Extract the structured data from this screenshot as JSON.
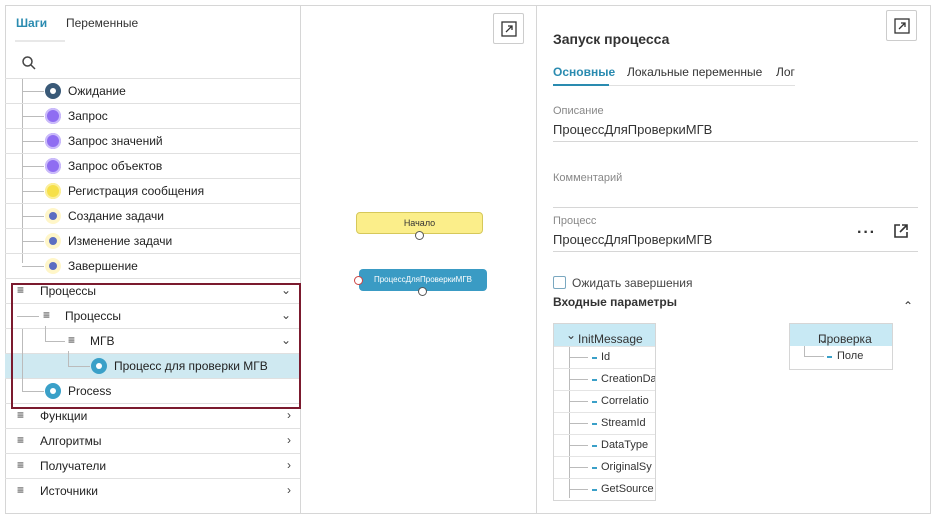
{
  "left_panel": {
    "tabs": [
      "Шаги",
      "Переменные"
    ],
    "steps": [
      {
        "label": "Ожидание",
        "icon": "gear-icon"
      },
      {
        "label": "Запрос",
        "icon": "request-icon"
      },
      {
        "label": "Запрос значений",
        "icon": "request-values-icon"
      },
      {
        "label": "Запрос объектов",
        "icon": "request-objects-icon"
      },
      {
        "label": "Регистрация сообщения",
        "icon": "message-icon"
      },
      {
        "label": "Создание задачи",
        "icon": "gear-icon"
      },
      {
        "label": "Изменение задачи",
        "icon": "gear-icon"
      },
      {
        "label": "Завершение",
        "icon": "gear-icon"
      }
    ],
    "groups": [
      {
        "label": "Процессы",
        "expanded": true
      },
      {
        "label": "Процессы",
        "expanded": true
      },
      {
        "label": "МГВ",
        "expanded": true
      }
    ],
    "selected_item": "Процесс для проверки МГВ",
    "process_item": "Process",
    "categories": [
      "Функции",
      "Алгоритмы",
      "Получатели",
      "Источники"
    ]
  },
  "canvas": {
    "start_node": "Начало",
    "process_node": "ПроцессДляПроверкиМГВ"
  },
  "right_panel": {
    "title": "Запуск процесса",
    "tabs": [
      "Основные",
      "Локальные переменные",
      "Лог"
    ],
    "description_label": "Описание",
    "description_value": "ПроцессДляПроверкиМГВ",
    "comment_label": "Комментарий",
    "process_label": "Процесс",
    "process_value": "ПроцессДляПроверкиМГВ",
    "more_label": "···",
    "wait_label": "Ожидать завершения",
    "wait_checked": false,
    "input_params_title": "Входные параметры",
    "source_header": "InitMessage",
    "source_fields": [
      "Id",
      "CreationDa",
      "Correlatio",
      "StreamId",
      "DataType",
      "OriginalSy",
      "GetSource"
    ],
    "target_header": "Проверка",
    "target_fields": [
      "Поле"
    ]
  },
  "colors": {
    "accent": "#2a8bb0",
    "highlight_border": "#7b1a2e",
    "selected_row": "#cfe9f1",
    "start_node": "#fbee8a",
    "process_node": "#3a9bc4"
  }
}
